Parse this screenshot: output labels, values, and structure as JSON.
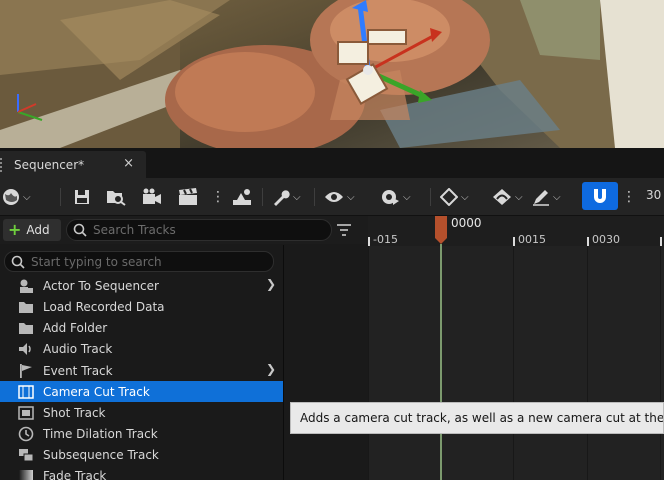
{
  "tab": {
    "title": "Sequencer*",
    "close": "×"
  },
  "toolbar": {
    "frame_rate": "30"
  },
  "track_header": {
    "add_label": "Add",
    "search_placeholder": "Search Tracks"
  },
  "timeline": {
    "current_time": "0000",
    "ticks": [
      "-015",
      "0015",
      "0030"
    ]
  },
  "add_menu": {
    "search_placeholder": "Start typing to search",
    "items": [
      {
        "label": "Actor To Sequencer",
        "icon": "actor-icon",
        "submenu": true
      },
      {
        "label": "Load Recorded Data",
        "icon": "folder-open-icon",
        "submenu": false
      },
      {
        "label": "Add Folder",
        "icon": "folder-icon",
        "submenu": false
      },
      {
        "label": "Audio Track",
        "icon": "speaker-icon",
        "submenu": false
      },
      {
        "label": "Event Track",
        "icon": "flag-icon",
        "submenu": true
      },
      {
        "label": "Camera Cut Track",
        "icon": "camera-cut-icon",
        "submenu": false,
        "selected": true
      },
      {
        "label": "Shot Track",
        "icon": "film-icon",
        "submenu": false
      },
      {
        "label": "Time Dilation Track",
        "icon": "clock-icon",
        "submenu": false
      },
      {
        "label": "Subsequence Track",
        "icon": "subsequence-icon",
        "submenu": false
      },
      {
        "label": "Fade Track",
        "icon": "fade-icon",
        "submenu": false
      }
    ]
  },
  "tooltip": {
    "text": "Adds a camera cut track, as well as a new camera cut at the current"
  },
  "colors": {
    "accent": "#0e6ae0",
    "selection": "#0f70d8",
    "add_plus": "#6fcf3e"
  }
}
